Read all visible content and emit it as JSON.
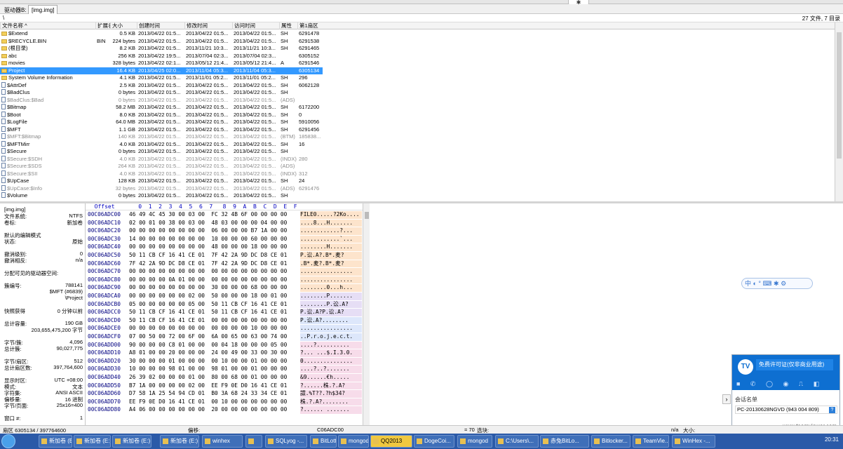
{
  "window": {
    "pin_icon": "pin-icon"
  },
  "tabbar": {
    "label": "驱动器B:",
    "tab": "[img.img]"
  },
  "pathbar": {
    "path": "\\",
    "count": "27 文件, 7 目录"
  },
  "filelist": {
    "columns": [
      "文件名称 ^",
      "扩展名",
      "大小",
      "创建时间",
      "修改时间",
      "访问时间",
      "属性",
      "第1扇区"
    ],
    "rows": [
      {
        "name": "$Extend",
        "ext": "",
        "size": "0.5 KB",
        "c": "2013/04/22  01:5...",
        "m": "2013/04/22  01:5...",
        "a": "2013/04/22  01:5...",
        "attr": "SH",
        "sec": "6291478",
        "type": "folder",
        "style": ""
      },
      {
        "name": "$RECYCLE.BIN",
        "ext": "BIN",
        "size": "224 bytes",
        "c": "2013/04/22  01:5...",
        "m": "2013/04/22  01:5...",
        "a": "2013/04/22  01:5...",
        "attr": "SH",
        "sec": "6291538",
        "type": "folder",
        "style": ""
      },
      {
        "name": "(根目录)",
        "ext": "",
        "size": "8.2 KB",
        "c": "2013/04/22  01:5...",
        "m": "2013/11/21  10:3...",
        "a": "2013/11/21  10:3...",
        "attr": "SH",
        "sec": "6291465",
        "type": "folder",
        "style": ""
      },
      {
        "name": "abc",
        "ext": "",
        "size": "256 KB",
        "c": "2013/04/22  19:5...",
        "m": "2013/07/04  02:3...",
        "a": "2013/07/04  02:3...",
        "attr": "",
        "sec": "6305152",
        "type": "folder",
        "style": ""
      },
      {
        "name": "movies",
        "ext": "",
        "size": "328 bytes",
        "c": "2013/04/22  02:1...",
        "m": "2013/05/12  21:4...",
        "a": "2013/05/12  21:4...",
        "attr": "A",
        "sec": "6291546",
        "type": "folder",
        "style": ""
      },
      {
        "name": "Project",
        "ext": "",
        "size": "16.4 KB",
        "c": "2013/04/25  02:0...",
        "m": "2013/11/04  05:3...",
        "a": "2013/11/04  05:3...",
        "attr": "",
        "sec": "6305134",
        "type": "folder",
        "style": "sel"
      },
      {
        "name": "System Volume Information",
        "ext": "",
        "size": "4.1 KB",
        "c": "2013/04/22  01:5...",
        "m": "2013/11/01  05:2...",
        "a": "2013/11/01  05:2...",
        "attr": "SH",
        "sec": "296",
        "type": "folder",
        "style": ""
      },
      {
        "name": "$AttrDef",
        "ext": "",
        "size": "2.5 KB",
        "c": "2013/04/22  01:5...",
        "m": "2013/04/22  01:5...",
        "a": "2013/04/22  01:5...",
        "attr": "SH",
        "sec": "6062128",
        "type": "file",
        "style": ""
      },
      {
        "name": "$BadClus",
        "ext": "",
        "size": "0 bytes",
        "c": "2013/04/22  01:5...",
        "m": "2013/04/22  01:5...",
        "a": "2013/04/22  01:5...",
        "attr": "SH",
        "sec": "",
        "type": "file",
        "style": ""
      },
      {
        "name": "$BadClus:$Bad",
        "ext": "",
        "size": "0 bytes",
        "c": "2013/04/22  01:5...",
        "m": "2013/04/22  01:5...",
        "a": "2013/04/22  01:5...",
        "attr": "(ADS)",
        "sec": "",
        "type": "file",
        "style": "dim"
      },
      {
        "name": "$Bitmap",
        "ext": "",
        "size": "58.2 MB",
        "c": "2013/04/22  01:5...",
        "m": "2013/04/22  01:5...",
        "a": "2013/04/22  01:5...",
        "attr": "SH",
        "sec": "6172200",
        "type": "file",
        "style": ""
      },
      {
        "name": "$Boot",
        "ext": "",
        "size": "8.0 KB",
        "c": "2013/04/22  01:5...",
        "m": "2013/04/22  01:5...",
        "a": "2013/04/22  01:5...",
        "attr": "SH",
        "sec": "0",
        "type": "file",
        "style": ""
      },
      {
        "name": "$LogFile",
        "ext": "",
        "size": "64.0 MB",
        "c": "2013/04/22  01:5...",
        "m": "2013/04/22  01:5...",
        "a": "2013/04/22  01:5...",
        "attr": "SH",
        "sec": "5910056",
        "type": "file",
        "style": ""
      },
      {
        "name": "$MFT",
        "ext": "",
        "size": "1.1 GB",
        "c": "2013/04/22  01:5...",
        "m": "2013/04/22  01:5...",
        "a": "2013/04/22  01:5...",
        "attr": "SH",
        "sec": "6291456",
        "type": "file",
        "style": ""
      },
      {
        "name": "$MFT:$Bitmap",
        "ext": "",
        "size": "140 KB",
        "c": "2013/04/22  01:5...",
        "m": "2013/04/22  01:5...",
        "a": "2013/04/22  01:5...",
        "attr": "(BTM)",
        "sec": "185838...",
        "type": "file",
        "style": "dim"
      },
      {
        "name": "$MFTMirr",
        "ext": "",
        "size": "4.0 KB",
        "c": "2013/04/22  01:5...",
        "m": "2013/04/22  01:5...",
        "a": "2013/04/22  01:5...",
        "attr": "SH",
        "sec": "16",
        "type": "file",
        "style": ""
      },
      {
        "name": "$Secure",
        "ext": "",
        "size": "0 bytes",
        "c": "2013/04/22  01:5...",
        "m": "2013/04/22  01:5...",
        "a": "2013/04/22  01:5...",
        "attr": "SH",
        "sec": "",
        "type": "file",
        "style": ""
      },
      {
        "name": "$Secure:$SDH",
        "ext": "",
        "size": "4.0 KB",
        "c": "2013/04/22  01:5...",
        "m": "2013/04/22  01:5...",
        "a": "2013/04/22  01:5...",
        "attr": "(INDX)",
        "sec": "280",
        "type": "file",
        "style": "dim"
      },
      {
        "name": "$Secure:$SDS",
        "ext": "",
        "size": "264 KB",
        "c": "2013/04/22  01:5...",
        "m": "2013/04/22  01:5...",
        "a": "2013/04/22  01:5...",
        "attr": "(ADS)",
        "sec": "",
        "type": "file",
        "style": "dim"
      },
      {
        "name": "$Secure:$SII",
        "ext": "",
        "size": "4.0 KB",
        "c": "2013/04/22  01:5...",
        "m": "2013/04/22  01:5...",
        "a": "2013/04/22  01:5...",
        "attr": "(INDX)",
        "sec": "312",
        "type": "file",
        "style": "dim"
      },
      {
        "name": "$UpCase",
        "ext": "",
        "size": "128 KB",
        "c": "2013/04/22  01:5...",
        "m": "2013/04/22  01:5...",
        "a": "2013/04/22  01:5...",
        "attr": "SH",
        "sec": "24",
        "type": "file",
        "style": ""
      },
      {
        "name": "$UpCase:$Info",
        "ext": "",
        "size": "32 bytes",
        "c": "2013/04/22  01:5...",
        "m": "2013/04/22  01:5...",
        "a": "2013/04/22  01:5...",
        "attr": "(ADS)",
        "sec": "6291476",
        "type": "file",
        "style": "dim"
      },
      {
        "name": "$Volume",
        "ext": "",
        "size": "0 bytes",
        "c": "2013/04/22  01:5...",
        "m": "2013/04/22  01:5...",
        "a": "2013/04/22  01:5...",
        "attr": "SH",
        "sec": "",
        "type": "file",
        "style": ""
      }
    ]
  },
  "infopanel": {
    "rows": [
      {
        "k": "[img.img]",
        "v": ""
      },
      {
        "k": "文件系统:",
        "v": "NTFS"
      },
      {
        "k": "卷标:",
        "v": "新加卷"
      },
      {
        "k": "",
        "v": ""
      },
      {
        "k": "默认的编辑模式",
        "v": ""
      },
      {
        "k": "状态:",
        "v": "原始"
      },
      {
        "k": "",
        "v": ""
      },
      {
        "k": "撤消级别:",
        "v": "0"
      },
      {
        "k": "撤消相反:",
        "v": "n/a"
      },
      {
        "k": "",
        "v": ""
      },
      {
        "k": "分配可见的驱动器空间:",
        "v": ""
      },
      {
        "k": "",
        "v": ""
      },
      {
        "k": "簇编号:",
        "v": "788141"
      },
      {
        "k": "",
        "v": "$MFT (#6839)"
      },
      {
        "k": "",
        "v": "\\Project"
      },
      {
        "k": "",
        "v": ""
      },
      {
        "k": "快照获得",
        "v": "0 分钟以前"
      },
      {
        "k": "",
        "v": ""
      },
      {
        "k": "总计容量:",
        "v": "190 GB"
      },
      {
        "k": "",
        "v": "203,655,475,200 字节"
      },
      {
        "k": "",
        "v": ""
      },
      {
        "k": "字节/簇:",
        "v": "4,096"
      },
      {
        "k": "总计簇:",
        "v": "90,027,775"
      },
      {
        "k": "",
        "v": ""
      },
      {
        "k": "字节/扇区:",
        "v": "512"
      },
      {
        "k": "总计扇区数:",
        "v": "397,764,600"
      },
      {
        "k": "",
        "v": ""
      },
      {
        "k": "显示时区:",
        "v": "UTC +08:00"
      },
      {
        "k": "模式:",
        "v": "文本"
      },
      {
        "k": "字符集:",
        "v": "ANSI ASCII"
      },
      {
        "k": "偏移量:",
        "v": "16 进制"
      },
      {
        "k": "字节/页面:",
        "v": "25x16=400"
      },
      {
        "k": "",
        "v": ""
      },
      {
        "k": "窗口 #:",
        "v": "1"
      }
    ]
  },
  "hexview": {
    "header": "  Offset       0  1  2  3  4  5  6  7   8  9  A  B  C  D  E  F",
    "rows": [
      {
        "off": "00C06ADC00",
        "b": "46 49 4C 45 30 00 03 00  FC 32 4B 6F 00 00 00 00",
        "t": "FILE0.....?2Ko....",
        "bg": "bg-orange"
      },
      {
        "off": "00C06ADC10",
        "b": "02 00 01 00 38 00 03 00  48 03 00 00 00 04 00 00",
        "t": "....8...H.......",
        "bg": "bg-orange"
      },
      {
        "off": "00C06ADC20",
        "b": "00 00 00 00 00 00 00 00  06 00 00 00 B7 1A 00 00",
        "t": "............?...",
        "bg": "bg-orange"
      },
      {
        "off": "00C06ADC30",
        "b": "14 00 00 00 00 00 00 00  10 00 00 00 60 00 00 00",
        "t": "............`...",
        "bg": "bg-orange"
      },
      {
        "off": "00C06ADC40",
        "b": "00 00 00 00 00 00 00 00  48 00 00 00 18 00 00 00",
        "t": "........H.......",
        "bg": "bg-orange"
      },
      {
        "off": "00C06ADC50",
        "b": "50 11 CB CF 16 41 CE 01  7F 42 2A 9D DC D8 CE 01",
        "t": "P.讼.A?.B*.麦?",
        "bg": "bg-orange"
      },
      {
        "off": "00C06ADC60",
        "b": "7F 42 2A 9D DC D8 CE 01  7F 42 2A 9D DC D8 CE 01",
        "t": ".B*.麦?.B*.麦?",
        "bg": "bg-orange"
      },
      {
        "off": "00C06ADC70",
        "b": "00 00 00 00 00 00 00 00  00 00 00 00 00 00 00 00",
        "t": "................",
        "bg": "bg-orange"
      },
      {
        "off": "00C06ADC80",
        "b": "00 00 00 00 0A 01 00 00  00 00 00 00 00 00 00 00",
        "t": "................",
        "bg": "bg-orange"
      },
      {
        "off": "00C06ADC90",
        "b": "00 00 00 00 00 00 00 00  30 00 00 00 68 00 00 00",
        "t": "........0...h...",
        "bg": "bg-orange"
      },
      {
        "off": "00C06ADCA0",
        "b": "00 00 00 00 00 00 02 00  50 00 00 00 18 00 01 00",
        "t": "........P.......",
        "bg": "bg-purple"
      },
      {
        "off": "00C06ADCB0",
        "b": "05 00 00 00 00 00 05 00  50 11 CB CF 16 41 CE 01",
        "t": "........P.讼.A?",
        "bg": "bg-purple"
      },
      {
        "off": "00C06ADCC0",
        "b": "50 11 CB CF 16 41 CE 01  50 11 CB CF 16 41 CE 01",
        "t": "P.讼.A?P.讼.A?",
        "bg": "bg-purple"
      },
      {
        "off": "00C06ADCD0",
        "b": "50 11 CB CF 16 41 CE 01  00 00 00 00 00 00 00 00",
        "t": "P.讼.A?........",
        "bg": "bg-blue"
      },
      {
        "off": "00C06ADCE0",
        "b": "00 00 00 00 00 00 00 00  00 00 00 00 10 00 00 00",
        "t": "................",
        "bg": "bg-blue"
      },
      {
        "off": "00C06ADCF0",
        "b": "07 00 50 00 72 00 6F 00  6A 00 65 00 63 00 74 00",
        "t": "..P.r.o.j.e.c.t.",
        "bg": "bg-blue"
      },
      {
        "off": "00C06ADD00",
        "b": "90 00 00 00 C8 01 00 00  00 04 18 00 00 00 05 00",
        "t": "....?..........",
        "bg": "bg-pink"
      },
      {
        "off": "00C06ADD10",
        "b": "A8 01 00 00 20 00 00 00  24 00 49 00 33 00 30 00",
        "t": "?... ...$.I.3.0.",
        "bg": "bg-pink"
      },
      {
        "off": "00C06ADD20",
        "b": "30 00 00 00 01 00 00 00  00 10 00 00 01 00 00 00",
        "t": "0...............",
        "bg": "bg-pink"
      },
      {
        "off": "00C06ADD30",
        "b": "10 00 00 00 98 01 00 00  98 01 00 00 01 00 00 00",
        "t": "....?..?.......",
        "bg": "bg-pink"
      },
      {
        "off": "00C06ADD40",
        "b": "26 39 02 00 00 00 01 00  80 00 68 00 01 00 00 00",
        "t": "&9......€h.....",
        "bg": "bg-pink"
      },
      {
        "off": "00C06ADD50",
        "b": "B7 1A 00 00 00 00 02 00  EE F9 0E D0 16 41 CE 01",
        "t": "?......株.?.A?",
        "bg": "bg-pink"
      },
      {
        "off": "00C06ADD60",
        "b": "D7 58 1A 25 54 94 CD 01  B0 3A 68 24 33 34 CE 01",
        "t": "譞.%T??.?h$34?",
        "bg": "bg-pink"
      },
      {
        "off": "00C06ADD70",
        "b": "EE F9 0E D0 16 41 CE 01  00 10 00 00 00 00 00 00",
        "t": "株.?.A?........",
        "bg": "bg-pink"
      },
      {
        "off": "00C06ADD80",
        "b": "A4 06 00 00 00 00 00 00  20 00 00 00 00 00 00 00",
        "t": "?...... .......",
        "bg": "bg-pink"
      }
    ]
  },
  "ime": {
    "text": "中 ◐ ° ⌨ ✱ ⚙"
  },
  "teamviewer": {
    "message": "免费许可证(仅非商业用途)",
    "contacts": "会话名单",
    "pc": "PC-20130628NGVD (943 004 809)",
    "url": "www.teamviewer.com",
    "tools": "■ ✆ ◯ ◉ ⎍ ◧",
    "logo": "TV"
  },
  "statusbar": {
    "sector": "扇区 6305134 / 397764600",
    "offset_label": "偏移:",
    "offset": "C06ADC00",
    "eq": "= 70",
    "sel": "选块:",
    "na": "n/a",
    "size": "大小:"
  },
  "taskbar": {
    "items": [
      "新加卷 (E:)",
      "新加卷 (E:)",
      "新加卷 (E:)",
      "新加卷 (E:)",
      "winhex",
      "",
      "SQLyog -...",
      "BitLotter...",
      "mongod...",
      "QQ2013",
      "DogeCoi...",
      "mongod",
      "C:\\Users\\...",
      "赤兔BitLo...",
      "Bitlocker...",
      "TeamVie...",
      "WinHex -..."
    ],
    "clock": "20:31"
  }
}
